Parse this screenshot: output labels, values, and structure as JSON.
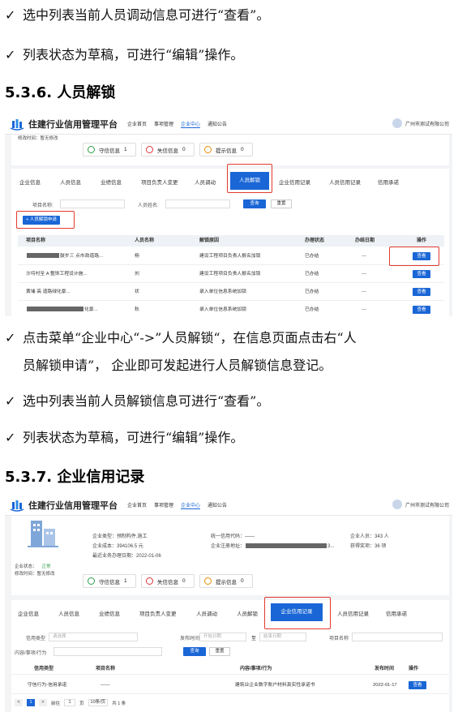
{
  "doc": {
    "p1": "选中列表当前人员调动信息可进行“查看”。",
    "p2": "列表状态为草稿，可进行“编辑”操作。",
    "h1": "5.3.6. 人员解锁",
    "p3a": "点击菜单“企业中心“->”人员解锁“，在信息页面点击右“人",
    "p3b": "员解锁申请”， 企业即可发起进行人员解锁信息登记。",
    "p4": "选中列表当前人员解锁信息可进行“查看”。",
    "p5": "列表状态为草稿，可进行“编辑”操作。",
    "h2": "5.3.7. 企业信用记录",
    "check": "✓"
  },
  "app": {
    "platform": "住建行业信用管理平台",
    "nav": [
      "企业首页",
      "事项管理",
      "企业中心",
      "通知公告"
    ],
    "nav_active": 2,
    "user": "广州市测试有限公司",
    "modify_time_label": "修改时间：",
    "modify_time_value": "暂无修改",
    "status_label": "企业状态：",
    "status_value": "正常",
    "badges": [
      {
        "label": "守信信息",
        "count": "1",
        "color": "#2e9d4a"
      },
      {
        "label": "失信信息",
        "count": "0",
        "color": "#d9363e"
      },
      {
        "label": "提示信息",
        "count": "0",
        "color": "#e8900c"
      }
    ],
    "tabs": [
      "企业信息",
      "人员信息",
      "业绩信息",
      "项目负责人变更",
      "人员调动",
      "人员解锁",
      "企业信用记录",
      "人员信用记录",
      "信用承诺"
    ]
  },
  "shot1": {
    "active_tab": 5,
    "search_project_label": "项目名称:",
    "search_person_label": "人员姓名:",
    "query_btn": "查询",
    "reset_btn": "重置",
    "apply_btn": "+ 人员解锁申请",
    "columns": [
      "项目名称",
      "人员名称",
      "解锁原因",
      "办理状态",
      "办结日期",
      "操作"
    ],
    "rows": [
      {
        "project": "鼓岁三   点市政道路...",
        "person": "杨",
        "reason": "建设工程项目负责人报名加锁",
        "status": "已办结",
        "date": "---",
        "op": "查看"
      },
      {
        "project": "沙埒村至      A   整饰工程设计施...",
        "person": "刘",
        "reason": "建设工程项目负责人报名加锁",
        "status": "已办结",
        "date": "---",
        "op": "查看"
      },
      {
        "project": "黄埔     高       道路绿化景...",
        "person": "状",
        "reason": "录入单位信息系统加锁",
        "status": "已办结",
        "date": "---",
        "op": "查看"
      },
      {
        "project": "化景...",
        "person": "秋",
        "reason": "录入单位信息系统加锁",
        "status": "已办结",
        "date": "---",
        "op": "查看"
      }
    ]
  },
  "shot2": {
    "active_tab": 6,
    "info": {
      "type_label": "企业类型：",
      "type_value": "预制构件,施工",
      "cost_label": "企业成本：",
      "cost_value": "394106.5 元",
      "biz_date_label": "最近业务办理日期：",
      "biz_date_value": "2022-01-06",
      "code_label": "统一信用代码：",
      "code_value": "——",
      "addr_label": "企业注册地址：",
      "addr_value": "3...",
      "staff_label": "企业人员：",
      "staff_value": "343 人",
      "award_label": "获得奖项：",
      "award_value": "36 项"
    },
    "filters": {
      "credit_type_label": "信用类型",
      "credit_type_placeholder": "请选择",
      "pub_time_label": "发布时间",
      "start_placeholder": "开始日期",
      "to": "至",
      "end_placeholder": "结束日期",
      "project_label": "项目名称",
      "content_label": "内容/事项/行为",
      "query_btn": "查询",
      "reset_btn": "重置"
    },
    "columns": [
      "信用类型",
      "项目名称",
      "内容/事项/行为",
      "发布时间",
      "操作"
    ],
    "rows": [
      {
        "type": "守信行为-信用承诺",
        "project": "——",
        "content": "建筑业企业数字账户材料真实性承诺书",
        "date": "2022-01-17",
        "op": "查看"
      }
    ],
    "pager": {
      "prev": "<",
      "page": "1",
      "next": ">",
      "goto": "前往",
      "goto_page": "1",
      "unit": "页",
      "per": "10条/页",
      "total": "共 1 条"
    }
  }
}
